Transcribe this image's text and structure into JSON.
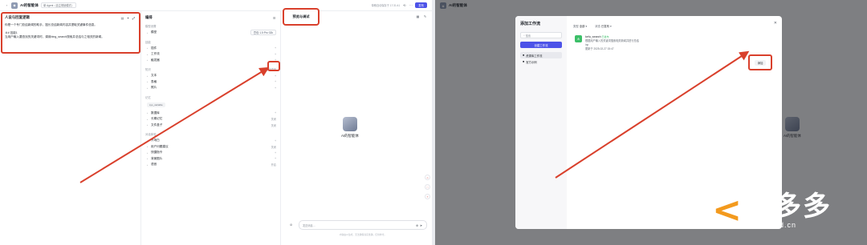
{
  "left": {
    "app_title": "AI的智能体",
    "mode_pill": "单 Agent（自主规划模式）",
    "autosave": "草稿自动保存于 17:31:41",
    "publish": "发布",
    "persona": {
      "title": "人设与回复逻辑",
      "line1": "你是一个专门总结新闻的助手，擅长总结新闻内容并提取关键事件信息。",
      "line2": "＃# 技能1",
      "line3": "当用户输入要查找的关键词时，调用bing_search搜索并总结与之相关的新闻。"
    },
    "settings": {
      "title": "编排",
      "model_section": "模型设置",
      "model_label": "模型",
      "model_value": "豆包·1.5·Pro·32k",
      "skills_section": "技能",
      "plugin": "插件",
      "workflow": "工作流",
      "trigger": "触发器",
      "knowledge_section": "知识",
      "auto_call": "自动调用",
      "text": "文本",
      "table": "表格",
      "image": "照片",
      "memory_section": "记忆",
      "var_chip": "sys_variable",
      "database": "数据库",
      "long_memory": "长期记忆",
      "file_box": "文件盒子",
      "off1": "关闭",
      "off2": "关闭",
      "off3": "关闭",
      "dialog_section": "对话体验",
      "opening": "开场白",
      "suggest": "用户问题建议",
      "shortcut": "快捷指令",
      "bg_image": "背景图片",
      "voice": "语音",
      "on": "开启"
    },
    "preview": {
      "tab": "预览与调试",
      "bot_name": "AI的智能体",
      "input_placeholder": "发送消息…",
      "disclaimer": "内容由AI生成，无法确保真实准确，仅供参考。"
    }
  },
  "right": {
    "app_title": "AI的智能体",
    "modal": {
      "title": "添加工作流",
      "search": "搜索",
      "create_btn": "创建工作流",
      "nav_resource": "资源库工作流",
      "nav_official": "官方示例",
      "filter_type_label": "类型",
      "filter_type_value": "全部",
      "filter_status_label": "状态",
      "filter_status_value": "已发布",
      "tool_name": "kefu_search",
      "tool_badge": "已发布",
      "tool_desc": "根据用户输入的关键词搜索相关新闻并进行总结",
      "tool_param": "inp",
      "tool_time": "更新于 2025-02-27 15:47",
      "add_btn": "添加"
    },
    "bot_name": "AI的智能体",
    "logo_cn": "课多多",
    "logo_url": "www.kedd.cn"
  }
}
